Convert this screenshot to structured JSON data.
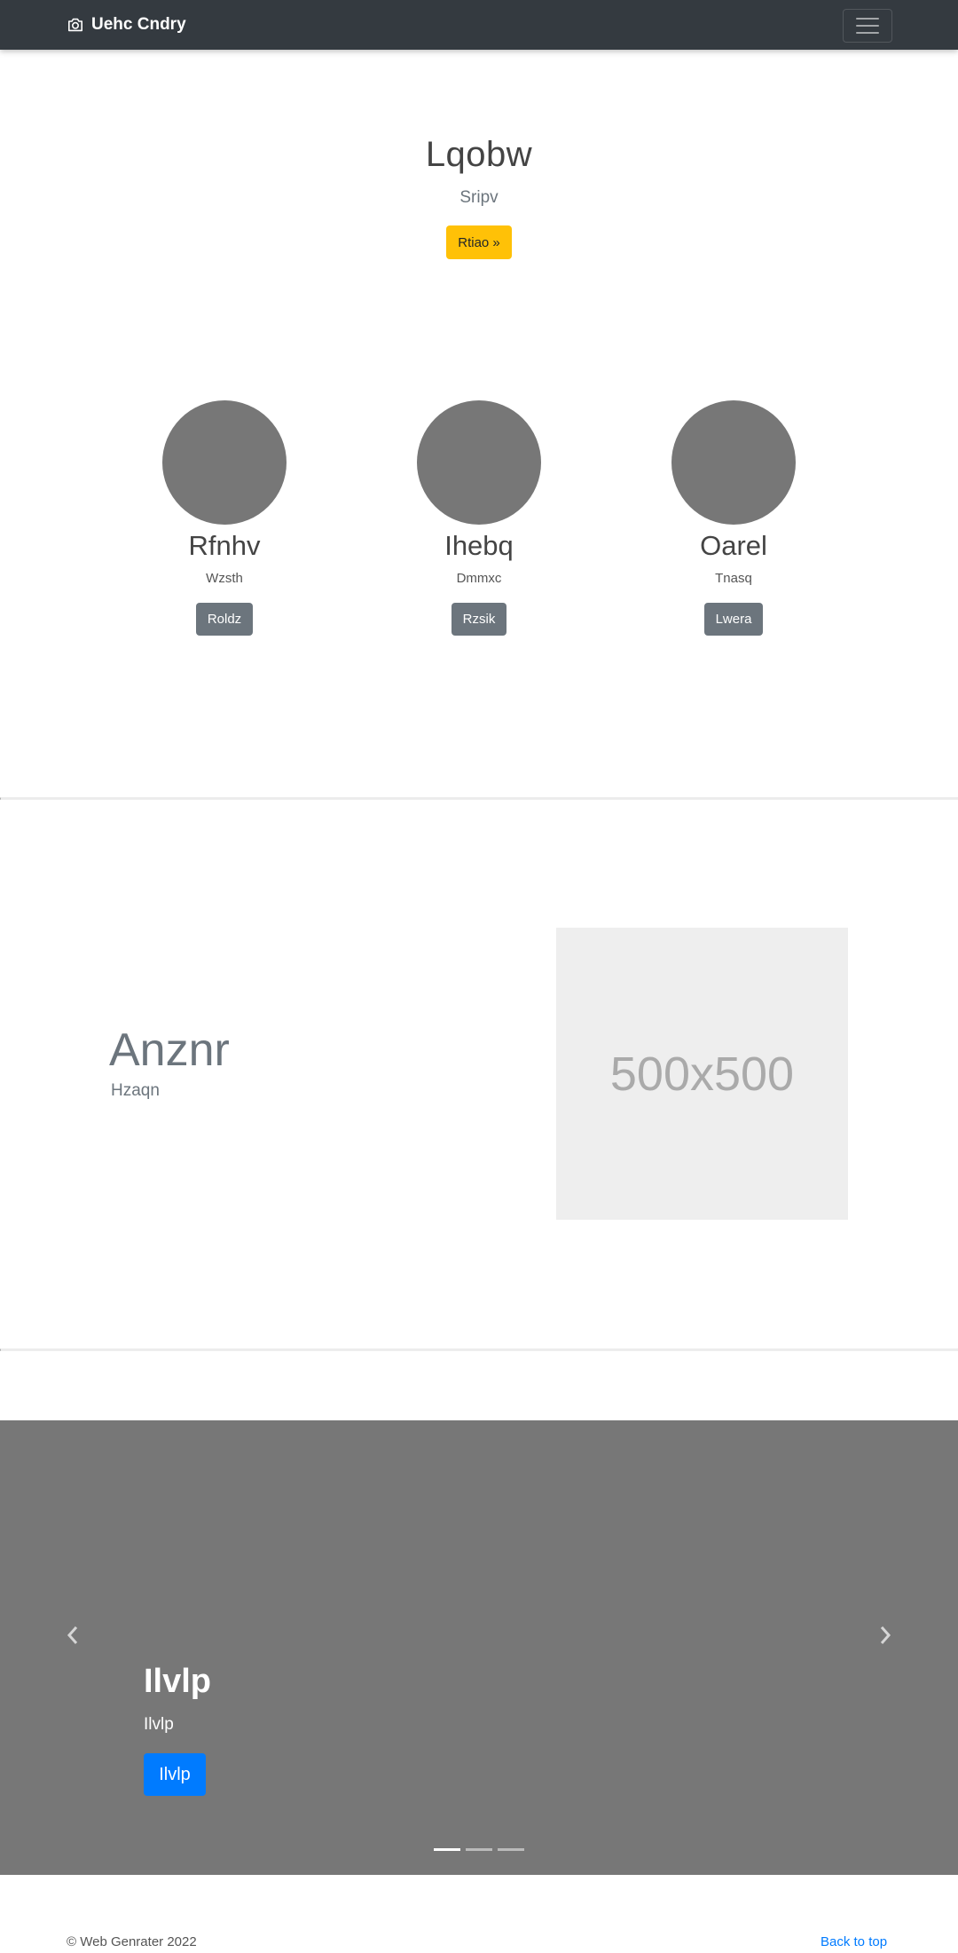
{
  "navbar": {
    "brand": "Uehc Cndry",
    "brand_icon": "camera-icon",
    "toggler_icon": "hamburger-menu-icon"
  },
  "hero": {
    "title": "Lqobw",
    "subtitle": "Sripv",
    "button_label": "Rtiao »"
  },
  "columns": [
    {
      "name": "Rfnhv",
      "desc": "Wzsth",
      "button_label": "Roldz"
    },
    {
      "name": "Ihebq",
      "desc": "Dmmxc",
      "button_label": "Rzsik"
    },
    {
      "name": "Oarel",
      "desc": "Tnasq",
      "button_label": "Lwera"
    }
  ],
  "featurette": {
    "title": "Anznr",
    "subtitle": "Hzaqn",
    "placeholder_label": "500x500"
  },
  "carousel": {
    "caption_title": "Ilvlp",
    "caption_text": "Ilvlp",
    "button_label": "Ilvlp",
    "prev_icon": "chevron-left-icon",
    "next_icon": "chevron-right-icon",
    "slide_count": 3,
    "active_slide": 1
  },
  "footer": {
    "copyright": "© Web Genrater 2022",
    "back_to_top": "Back to top"
  },
  "colors": {
    "navbar_bg": "#343a40",
    "hero_button": "#ffc107",
    "secondary_button": "#6c757d",
    "primary_button": "#007bff",
    "placeholder_circle": "#777777",
    "carousel_bg": "#777777"
  }
}
